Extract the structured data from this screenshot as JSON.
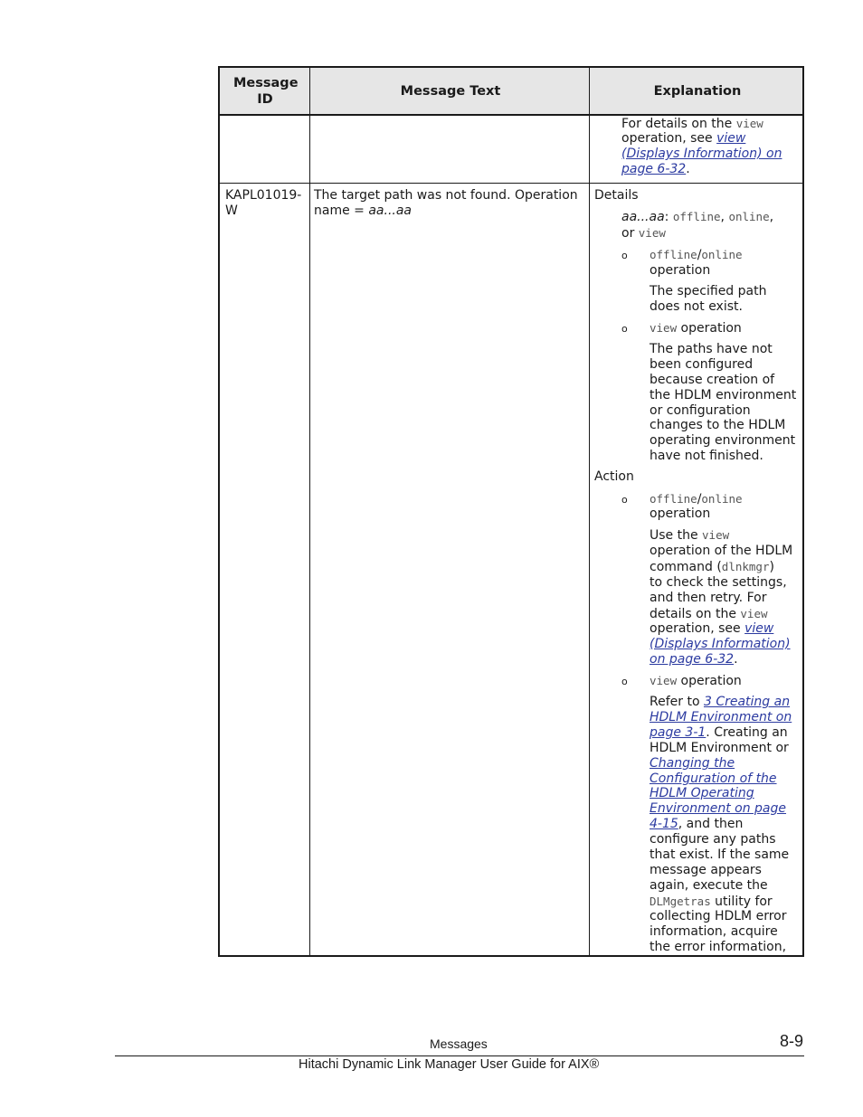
{
  "table": {
    "headers": [
      "Message ID",
      "Message Text",
      "Explanation"
    ],
    "continued_row": {
      "explanation": {
        "t1": "For details on the ",
        "m1": "view",
        "t2": "operation, see ",
        "link1": "view",
        "link2": "(Displays Information) on",
        "link3": "page 6-32",
        "t3": "."
      }
    },
    "row": {
      "id_line1": "KAPL01019-",
      "id_line2": "W",
      "text_line1": "The target path was not found. Operation",
      "text_line2_plain": "name = ",
      "text_line2_italic": "aa...aa",
      "details_label": "Details",
      "details": {
        "var": "aa...aa",
        "colon": ": ",
        "m_offline": "offline",
        "comma1": ", ",
        "m_online": "online",
        "comma2": ",",
        "or": "or ",
        "m_view": "view",
        "bullet1_m1": "offline",
        "slash": "/",
        "bullet1_m2": "online",
        "bullet1_suffix": "operation",
        "bullet1_text": [
          "The specified path",
          "does not exist."
        ],
        "bullet2_m": "view",
        "bullet2_suffix": " operation",
        "bullet2_text": [
          "The paths have not",
          "been configured",
          "because creation of",
          "the HDLM environment",
          "or configuration",
          "changes to the HDLM",
          "operating environment",
          "have not finished."
        ]
      },
      "action_label": "Action",
      "action": {
        "b1_m1": "offline",
        "slash": "/",
        "b1_m2": "online",
        "b1_suffix": "operation",
        "b1_l1a": "Use the ",
        "b1_l1m": "view",
        "b1_l2": "operation of the HDLM",
        "b1_l3a": "command (",
        "b1_l3m": "dlnkmgr",
        "b1_l3b": ")",
        "b1_l4": "to check the settings,",
        "b1_l5": "and then retry. For",
        "b1_l6a": "details on the ",
        "b1_l6m": "view",
        "b1_l7a": "operation, see ",
        "b1_l7link": "view",
        "b1_l8link": "(Displays Information)",
        "b1_l9link": "on page 6-32",
        "b1_l9b": ".",
        "b2_m": "view",
        "b2_suffix": " operation",
        "b2_l1a": "Refer to ",
        "b2_l1link": "3 Creating an",
        "b2_l2link": "HDLM Environment on",
        "b2_l3link": "page 3-1",
        "b2_l3b": ". Creating an",
        "b2_l4": "HDLM Environment or",
        "b2_l5link": "Changing the",
        "b2_l6link": "Configuration of the",
        "b2_l7link": "HDLM Operating",
        "b2_l8link": "Environment on page",
        "b2_l9link": "4-15",
        "b2_l9b": ", and then",
        "b2_rest": [
          "configure any paths",
          "that exist. If the same",
          "message appears",
          "again, execute the"
        ],
        "b2_l14m": "DLMgetras",
        "b2_l14b": " utility for",
        "b2_tail": [
          "collecting HDLM error",
          "information, acquire",
          "the error information,"
        ]
      }
    }
  },
  "footer": {
    "section": "Messages",
    "page": "8-9",
    "title": "Hitachi Dynamic Link Manager User Guide for AIX®"
  }
}
